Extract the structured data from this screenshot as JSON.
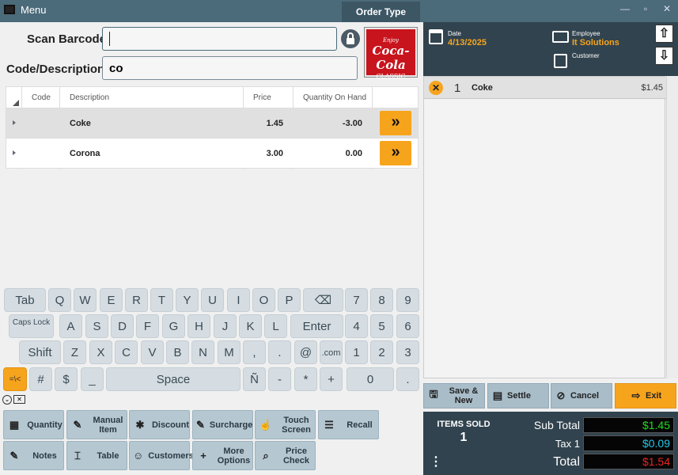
{
  "window": {
    "title": "Menu",
    "order_type_tab": "Order Type",
    "min": "—",
    "restore": "▫",
    "close": "✕"
  },
  "scan": {
    "label": "Scan Barcode",
    "value": ""
  },
  "code": {
    "label": "Code/Description",
    "value": "co"
  },
  "logo": {
    "line1": "Enjoy",
    "line2": "Coca-Cola",
    "line3": "CLASSIC"
  },
  "grid": {
    "headers": [
      "Code",
      "Description",
      "Price",
      "Quantity On Hand"
    ],
    "rows": [
      {
        "code": "",
        "description": "Coke",
        "price": "1.45",
        "qty": "-3.00"
      },
      {
        "code": "",
        "description": "Corona",
        "price": "3.00",
        "qty": "0.00"
      }
    ]
  },
  "keyboard": {
    "row1": [
      "Tab",
      "Q",
      "W",
      "E",
      "R",
      "T",
      "Y",
      "U",
      "I",
      "O",
      "P",
      "⌫",
      "7",
      "8",
      "9"
    ],
    "row2": [
      "Caps Lock",
      "A",
      "S",
      "D",
      "F",
      "G",
      "H",
      "J",
      "K",
      "L",
      "Enter",
      "4",
      "5",
      "6"
    ],
    "row3": [
      "Shift",
      "Z",
      "X",
      "C",
      "V",
      "B",
      "N",
      "M",
      ",",
      ".",
      "@",
      ".com",
      "1",
      "2",
      "3"
    ],
    "row4": [
      "=\\<",
      "#",
      "$",
      "_",
      "Space",
      "Ñ",
      "-",
      "*",
      "+",
      "0",
      "."
    ]
  },
  "functions": {
    "row1": [
      {
        "label": "Quantity",
        "icon": "quantity-icon",
        "glyph": "▦"
      },
      {
        "label": "Manual Item",
        "icon": "manual-item-icon",
        "glyph": "✎"
      },
      {
        "label": "Discount",
        "icon": "discount-icon",
        "glyph": "✱"
      },
      {
        "label": "Surcharge",
        "icon": "surcharge-icon",
        "glyph": "✎"
      },
      {
        "label": "Touch Screen",
        "icon": "touch-screen-icon",
        "glyph": "☝"
      },
      {
        "label": "Recall",
        "icon": "recall-icon",
        "glyph": "☰"
      }
    ],
    "row2": [
      {
        "label": "Notes",
        "icon": "notes-icon",
        "glyph": "✎"
      },
      {
        "label": "Table",
        "icon": "table-icon",
        "glyph": "⌶"
      },
      {
        "label": "Customers",
        "icon": "customers-icon",
        "glyph": "☺"
      },
      {
        "label": "More Options",
        "icon": "plus-icon",
        "glyph": "+"
      },
      {
        "label": "Price Check",
        "icon": "price-check-icon",
        "glyph": "⌕"
      }
    ]
  },
  "header": {
    "date_label": "Date",
    "date_value": "4/13/2025",
    "employee_label": "Employee",
    "employee_value": "It Solutions",
    "customer_label": "Customer",
    "customer_value": ""
  },
  "order_lines": [
    {
      "qty": "1",
      "name": "Coke",
      "price": "$1.45"
    }
  ],
  "actions": {
    "save_new": "Save & New",
    "settle": "Settle",
    "cancel": "Cancel",
    "exit": "Exit"
  },
  "totals": {
    "items_sold_label": "ITEMS SOLD",
    "items_sold": "1",
    "subtotal_label": "Sub Total",
    "subtotal": "$1.45",
    "tax_label": "Tax 1",
    "tax": "$0.09",
    "total_label": "Total",
    "total": "$1.54"
  },
  "colors": {
    "accent": "#f7a41d",
    "subtotal": "#22dd22",
    "tax": "#22c7e8",
    "total": "#ee2222"
  }
}
